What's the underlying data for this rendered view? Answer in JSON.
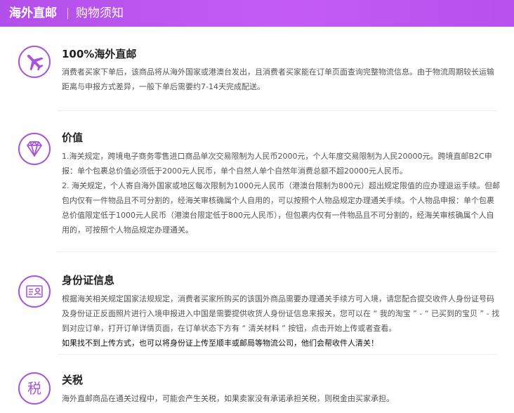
{
  "header": {
    "title": "海外直邮",
    "subtitle": "购物须知"
  },
  "sections": [
    {
      "icon": "airplane-icon",
      "title": "100%海外直邮",
      "lines": [
        "消费者买家下单后，该商品将从海外国家或港澳台发出，且消费者买家能在订单页面查询完整物流信息。由于物流周期较长运输距离与申报方式差异，一般下单后需要约7-14天完成配送。"
      ]
    },
    {
      "icon": "diamond-icon",
      "title": "价值",
      "lines": [
        "1.海关规定，跨境电子商务零售进口商品单次交易限制为人民币2000元，个人年度交易限制为人民20000元。跨境直邮B2C申报：单个包裹总价值必须低于2000元人民币，单个自然人单个自然年消费总额不超20000元人民币。",
        "2. 海关规定，个人寄自海外国家或地区每次限制为1000元人民币（港澳台限制为800元）超出规定限值的应办理退运手续。但邮包内仅有一件物品且不可分割的，经海关审核确属个人自用的，可以按照个人物品规定办理通关手续。个人物品申报：单个包裹总价值限定低于1000元人民币（港澳台限定低于800元人民币），但包裹内仅有一件物品且不可分割的，经海关审核确属个人自用的，可按照个人物品规定办理通关。"
      ]
    },
    {
      "icon": "id-card-icon",
      "title": "身份证信息",
      "lines": [
        "根据海关相关规定国家法规规定，消费者买家所购买的该国外商品需要办理通关手续方可入境，请您配合提交收件人身份证号码及身份证正反面照片进行入境申报进入中国是需要提供收货人身份证信息来报关，您可以在 “ 我的淘宝 ” - “ 已买到的宝贝 ” - 找到对应订单，打开订单详情页面，在订单状态下方有 “ 清关材料 ” 按钮，点击开始上传或者查看。",
        "如果找不到上传方式，也可以将身份证上传至顺丰或邮局等物流公司，他们会帮收件人清关！"
      ]
    },
    {
      "icon": "tax-icon",
      "icon_glyph": "税",
      "title": "关税",
      "lines": [
        "海外直邮商品在通关过程中，可能会产生关税，如果卖家没有承诺承担关税，则税金由买家承担。"
      ]
    }
  ]
}
